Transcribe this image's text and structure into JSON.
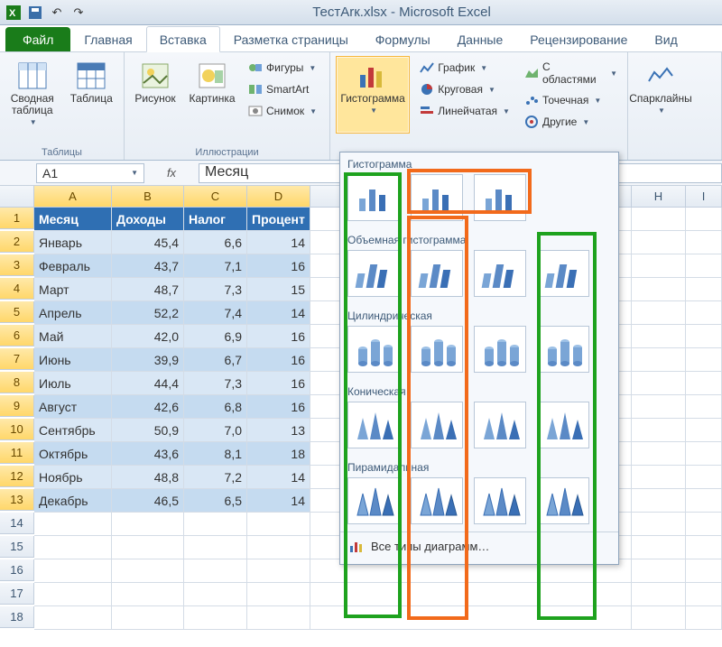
{
  "title": "ТестАrк.xlsx - Microsoft Excel",
  "tabs": {
    "file": "Файл",
    "home": "Главная",
    "insert": "Вставка",
    "layout": "Разметка страницы",
    "formulas": "Формулы",
    "data_tab": "Данные",
    "review": "Рецензирование",
    "view": "Вид"
  },
  "ribbon": {
    "tables": {
      "pivot": "Сводная таблица",
      "table": "Таблица",
      "group": "Таблицы"
    },
    "illus": {
      "picture": "Рисунок",
      "clipart": "Картинка",
      "shapes": "Фигуры",
      "smartart": "SmartArt",
      "screenshot": "Снимок",
      "group": "Иллюстрации"
    },
    "charts": {
      "column": "Гистограмма",
      "line": "График",
      "pie": "Круговая",
      "bar": "Линейчатая",
      "area": "С областями",
      "scatter": "Точечная",
      "other": "Другие"
    },
    "spark": {
      "label": "Спарклайны"
    }
  },
  "namebox": "A1",
  "fx_value": "Месяц",
  "gallery": {
    "sec1": "Гистограмма",
    "sec2": "Объемная гистограмма",
    "sec3": "Цилиндрическая",
    "sec4": "Коническая",
    "sec5": "Пирамидальная",
    "all": "Все типы диаграмм…"
  },
  "cols": [
    "A",
    "B",
    "C",
    "D",
    "",
    "H",
    "I"
  ],
  "headers": {
    "a": "Месяц",
    "b": "Доходы",
    "c": "Налог",
    "d": "Процент"
  },
  "rows": [
    {
      "n": "1"
    },
    {
      "n": "2",
      "a": "Январь",
      "b": "45,4",
      "c": "6,6",
      "d": "14"
    },
    {
      "n": "3",
      "a": "Февраль",
      "b": "43,7",
      "c": "7,1",
      "d": "16"
    },
    {
      "n": "4",
      "a": "Март",
      "b": "48,7",
      "c": "7,3",
      "d": "15"
    },
    {
      "n": "5",
      "a": "Апрель",
      "b": "52,2",
      "c": "7,4",
      "d": "14"
    },
    {
      "n": "6",
      "a": "Май",
      "b": "42,0",
      "c": "6,9",
      "d": "16"
    },
    {
      "n": "7",
      "a": "Июнь",
      "b": "39,9",
      "c": "6,7",
      "d": "16"
    },
    {
      "n": "8",
      "a": "Июль",
      "b": "44,4",
      "c": "7,3",
      "d": "16"
    },
    {
      "n": "9",
      "a": "Август",
      "b": "42,6",
      "c": "6,8",
      "d": "16"
    },
    {
      "n": "10",
      "a": "Сентябрь",
      "b": "50,9",
      "c": "7,0",
      "d": "13"
    },
    {
      "n": "11",
      "a": "Октябрь",
      "b": "43,6",
      "c": "8,1",
      "d": "18"
    },
    {
      "n": "12",
      "a": "Ноябрь",
      "b": "48,8",
      "c": "7,2",
      "d": "14"
    },
    {
      "n": "13",
      "a": "Декабрь",
      "b": "46,5",
      "c": "6,5",
      "d": "14"
    },
    {
      "n": "14"
    },
    {
      "n": "15"
    },
    {
      "n": "16"
    },
    {
      "n": "17"
    },
    {
      "n": "18"
    }
  ]
}
